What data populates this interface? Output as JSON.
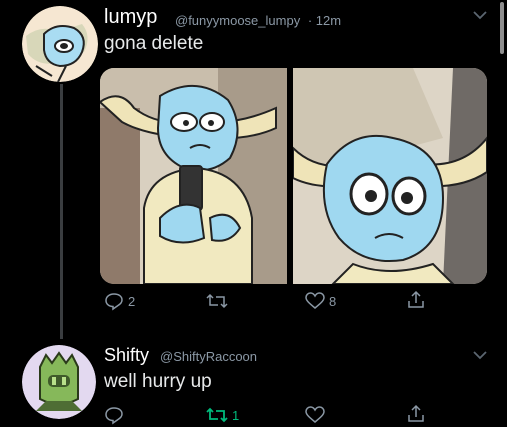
{
  "tweet1": {
    "name": "lumyp",
    "handle": "@funyymoose_lumpy",
    "time": "· 12m",
    "text": "gona delete",
    "replies": "2",
    "retweets": "",
    "likes": "8"
  },
  "tweet2": {
    "name": "Shifty",
    "handle": "@ShiftyRaccoon",
    "text": "well hurry up",
    "replies": "",
    "retweets": "1",
    "likes": ""
  },
  "colors": {
    "background": "#000000",
    "muted": "#8b98a5",
    "retweet_active": "#00ba7c",
    "character_blue": "#9fd8f0"
  }
}
